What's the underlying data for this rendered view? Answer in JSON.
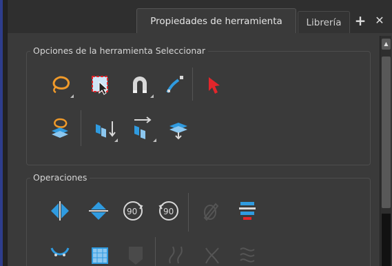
{
  "tabs": {
    "active_label": "Propiedades de herramienta",
    "inactive_label": "Librería",
    "add_symbol": "+",
    "close_symbol": "✕"
  },
  "groups": {
    "select_options": {
      "title": "Opciones de la herramienta Seleccionar",
      "icons": [
        "lasso-select-icon",
        "marquee-select-icon",
        "magnet-snap-icon",
        "bezier-curve-icon",
        "red-cursor-icon",
        "lasso-layers-icon",
        "distribute-vertical-icon",
        "distribute-horizontal-icon",
        "stack-layers-icon"
      ]
    },
    "operations": {
      "title": "Operaciones",
      "icons": [
        "flip-horizontal-icon",
        "flip-vertical-icon",
        "rotate-90-cw-icon",
        "rotate-90-ccw-icon",
        "edit-pen-disabled-icon",
        "align-bottom-icon",
        "smooth-curve-icon",
        "grid-select-icon",
        "stamp-disabled-icon",
        "curve-disabled-icon",
        "cross-disabled-icon",
        "wave-disabled-icon"
      ]
    }
  },
  "colors": {
    "accent_blue": "#2f9be0",
    "accent_orange": "#f09a2a",
    "cursor_red": "#e2262b",
    "panel_bg": "#3a3a3a"
  }
}
